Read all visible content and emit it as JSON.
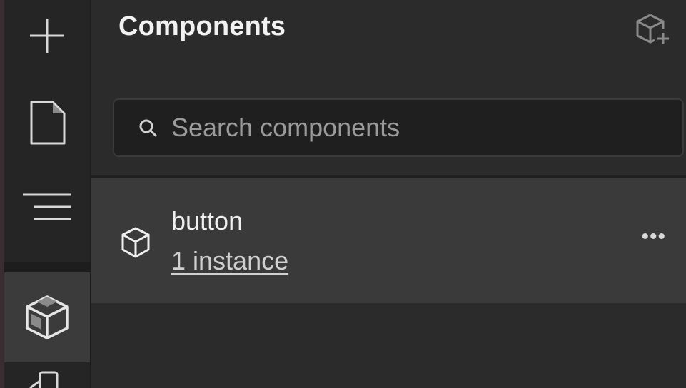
{
  "panel": {
    "title": "Components"
  },
  "search": {
    "placeholder": "Search components",
    "value": ""
  },
  "components": [
    {
      "name": "button",
      "instances_label": "1 instance",
      "more_label": "•••"
    }
  ],
  "rail": {
    "items": [
      {
        "icon": "plus-icon"
      },
      {
        "icon": "page-icon"
      },
      {
        "icon": "navigator-icon"
      },
      {
        "icon": "components-icon",
        "active": true
      },
      {
        "icon": "assets-icon"
      }
    ]
  },
  "colors": {
    "background": "#2b2b2b",
    "rail": "#252525",
    "row_selected": "#3a3a3a",
    "search_bg": "#1f1f1f",
    "text": "#f0f0f0",
    "muted": "#9a9a9a"
  }
}
